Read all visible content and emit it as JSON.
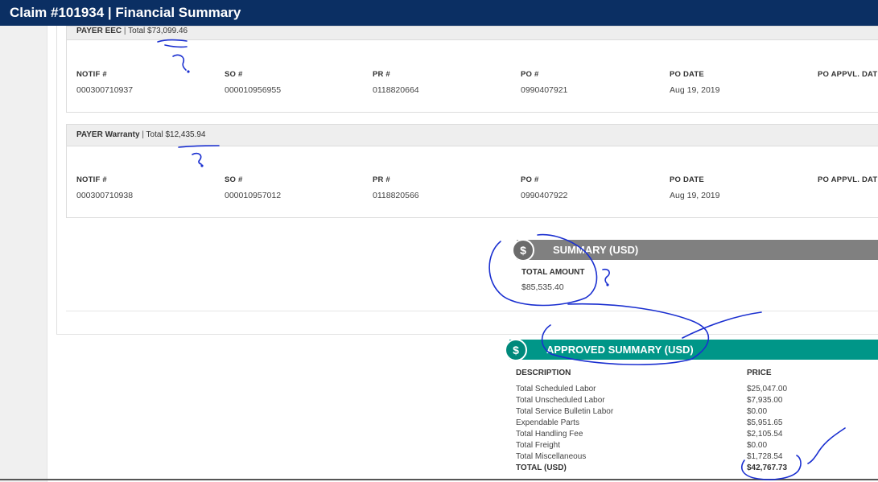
{
  "title": "Claim #101934 | Financial Summary",
  "payers": [
    {
      "name": "PAYER EEC",
      "sep": "|",
      "total": "Total $73,099.46",
      "fields": [
        {
          "label": "NOTIF #",
          "value": "000300710937"
        },
        {
          "label": "SO #",
          "value": "000010956955"
        },
        {
          "label": "PR #",
          "value": "0118820664"
        },
        {
          "label": "PO #",
          "value": "0990407921"
        },
        {
          "label": "PO DATE",
          "value": "Aug 19, 2019"
        },
        {
          "label": "PO APPVL. DATE",
          "value": ""
        }
      ]
    },
    {
      "name": "PAYER Warranty",
      "sep": "|",
      "total": "Total $12,435.94",
      "fields": [
        {
          "label": "NOTIF #",
          "value": "000300710938"
        },
        {
          "label": "SO #",
          "value": "000010957012"
        },
        {
          "label": "PR #",
          "value": "0118820566"
        },
        {
          "label": "PO #",
          "value": "0990407922"
        },
        {
          "label": "PO DATE",
          "value": "Aug 19, 2019"
        },
        {
          "label": "PO APPVL. DATE",
          "value": ""
        }
      ]
    }
  ],
  "summary": {
    "icon": "dollar-icon",
    "glyph": "$",
    "title": "SUMMARY (USD)",
    "total_label": "TOTAL AMOUNT",
    "total_value": "$85,535.40",
    "color": "#808080"
  },
  "approved": {
    "icon": "dollar-icon",
    "glyph": "$",
    "title": "APPROVED SUMMARY (USD)",
    "color": "#009688",
    "col_description": "DESCRIPTION",
    "col_price": "PRICE",
    "rows": [
      {
        "desc": "Total Scheduled Labor",
        "price": "$25,047.00"
      },
      {
        "desc": "Total Unscheduled Labor",
        "price": "$7,935.00"
      },
      {
        "desc": "Total Service Bulletin Labor",
        "price": "$0.00"
      },
      {
        "desc": "Expendable Parts",
        "price": "$5,951.65"
      },
      {
        "desc": "Total Handling Fee",
        "price": "$2,105.54"
      },
      {
        "desc": "Total Freight",
        "price": "$0.00"
      },
      {
        "desc": "Total Miscellaneous",
        "price": "$1,728.54"
      }
    ],
    "total_desc": "TOTAL (USD)",
    "total_price": "$42,767.73"
  },
  "colors": {
    "titlebar": "#0b2f63",
    "annotation_ink": "#1a2fd0"
  }
}
